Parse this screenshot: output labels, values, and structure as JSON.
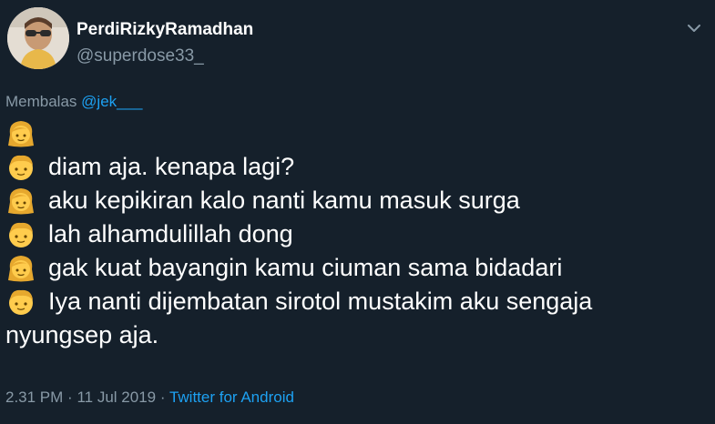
{
  "author": {
    "display_name": "PerdiRizkyRamadhan",
    "handle": "@superdose33_"
  },
  "reply": {
    "prefix": "Membalas",
    "mention": "@jek___"
  },
  "lines": [
    {
      "emoji": "girl-emoji",
      "text": ""
    },
    {
      "emoji": "boy-emoji",
      "text": "diam aja. kenapa lagi?"
    },
    {
      "emoji": "girl-emoji",
      "text": "aku kepikiran kalo nanti kamu masuk surga"
    },
    {
      "emoji": "boy-emoji",
      "text": "lah alhamdulillah dong"
    },
    {
      "emoji": "girl-emoji",
      "text": "gak kuat bayangin kamu ciuman sama bidadari"
    },
    {
      "emoji": "boy-emoji",
      "text": "Iya nanti dijembatan sirotol mustakim aku sengaja"
    },
    {
      "emoji": "",
      "text": "nyungsep aja."
    }
  ],
  "meta": {
    "time": "2.31 PM",
    "separator1": "·",
    "date": "11 Jul 2019",
    "separator2": "·",
    "source": "Twitter for Android"
  },
  "colors": {
    "background": "#15202b",
    "secondary_text": "#8899a6",
    "link": "#1da1f2"
  }
}
